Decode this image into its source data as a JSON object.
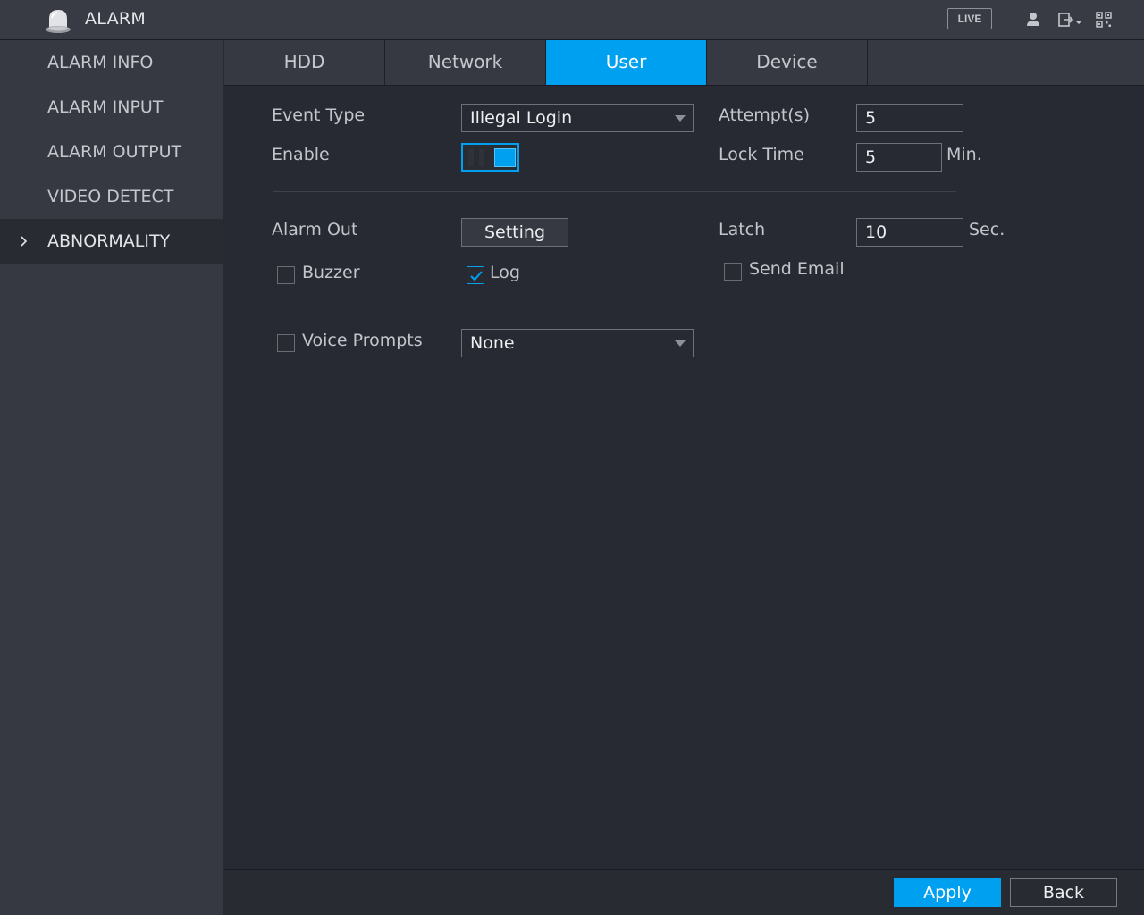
{
  "header": {
    "title": "ALARM",
    "live_label": "LIVE",
    "icons": [
      "alarm-bell-icon",
      "user-icon",
      "logout-icon",
      "qr-code-icon"
    ]
  },
  "sidebar": {
    "items": [
      {
        "label": "ALARM INFO",
        "active": false
      },
      {
        "label": "ALARM INPUT",
        "active": false
      },
      {
        "label": "ALARM OUTPUT",
        "active": false
      },
      {
        "label": "VIDEO DETECT",
        "active": false
      },
      {
        "label": "ABNORMALITY",
        "active": true
      }
    ]
  },
  "tabs": [
    {
      "label": "HDD",
      "active": false
    },
    {
      "label": "Network",
      "active": false
    },
    {
      "label": "User",
      "active": true
    },
    {
      "label": "Device",
      "active": false
    }
  ],
  "form": {
    "event_type_label": "Event Type",
    "event_type_value": "Illegal Login",
    "attempts_label": "Attempt(s)",
    "attempts_value": "5",
    "enable_label": "Enable",
    "enable_on": true,
    "lock_time_label": "Lock Time",
    "lock_time_value": "5",
    "lock_time_unit": "Min.",
    "alarm_out_label": "Alarm Out",
    "setting_label": "Setting",
    "latch_label": "Latch",
    "latch_value": "10",
    "latch_unit": "Sec.",
    "buzzer_label": "Buzzer",
    "buzzer_checked": false,
    "log_label": "Log",
    "log_checked": true,
    "send_email_label": "Send Email",
    "send_email_checked": false,
    "voice_prompts_label": "Voice Prompts",
    "voice_prompts_checked": false,
    "voice_prompts_value": "None"
  },
  "footer": {
    "apply_label": "Apply",
    "back_label": "Back"
  },
  "colors": {
    "accent": "#00a0f0",
    "background": "#282a33",
    "panel": "#363842"
  }
}
